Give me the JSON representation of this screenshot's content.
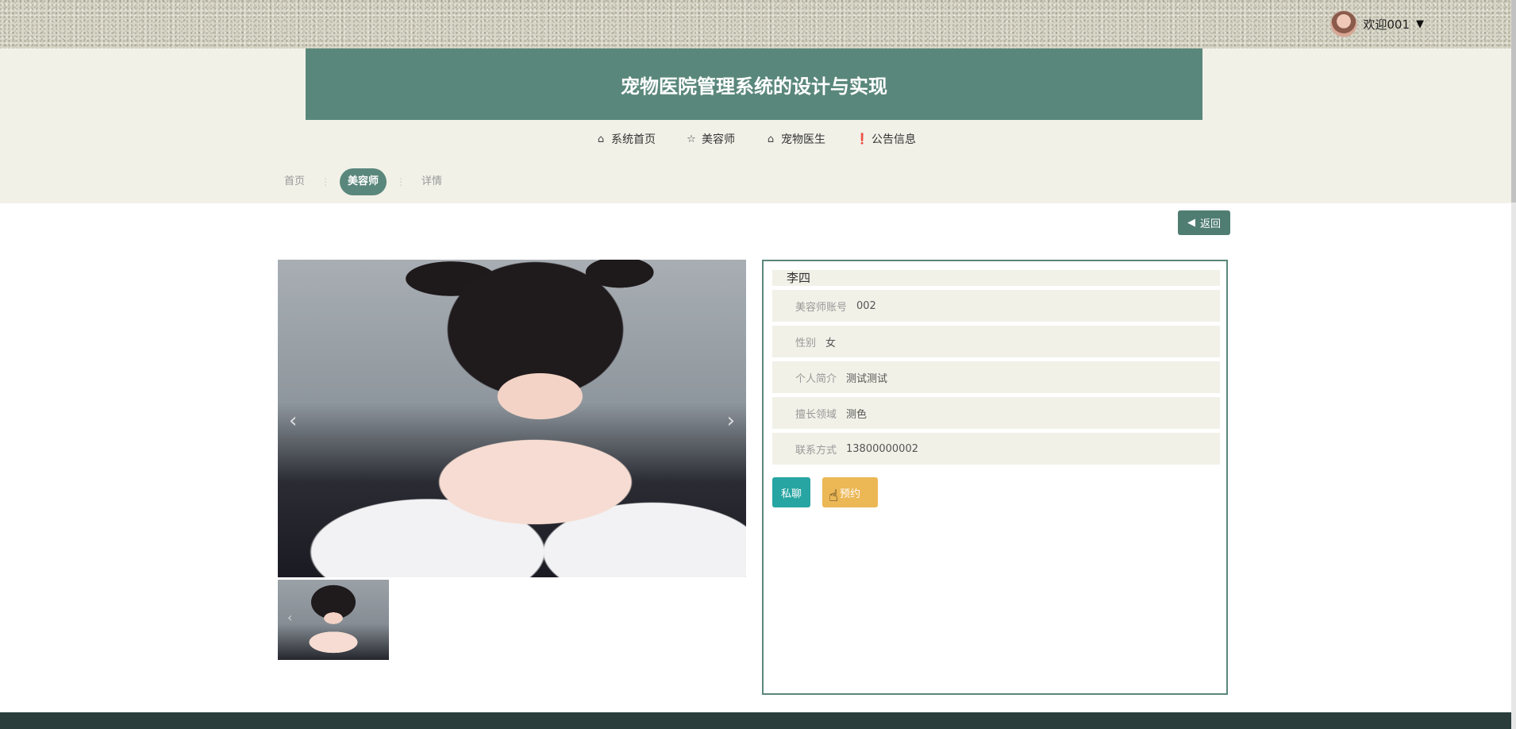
{
  "header": {
    "user_greeting": "欢迎001",
    "site_title": "宠物医院管理系统的设计与实现"
  },
  "nav": {
    "items": [
      {
        "label": "系统首页",
        "icon": "home-icon",
        "glyph": "⌂"
      },
      {
        "label": "美容师",
        "icon": "star-icon",
        "glyph": "☆"
      },
      {
        "label": "宠物医生",
        "icon": "bag-icon",
        "glyph": "⌂"
      },
      {
        "label": "公告信息",
        "icon": "info-icon",
        "glyph": "❗"
      }
    ]
  },
  "breadcrumb": {
    "home": "首页",
    "current": "美容师",
    "detail": "详情",
    "separator": "⋮"
  },
  "actions": {
    "back_label": "返回"
  },
  "profile": {
    "name": "李四",
    "fields": [
      {
        "label": "美容师账号",
        "value": "002"
      },
      {
        "label": "性别",
        "value": "女"
      },
      {
        "label": "个人简介",
        "value": "测试测试"
      },
      {
        "label": "擅长领域",
        "value": "测色"
      },
      {
        "label": "联系方式",
        "value": "13800000002"
      }
    ],
    "chat_label": "私聊",
    "book_label": "预约"
  },
  "colors": {
    "primary": "#5a877b",
    "band": "#f1f1e8",
    "chat": "#27a5a2",
    "book": "#ecb755",
    "footer": "#2a3d3a"
  }
}
